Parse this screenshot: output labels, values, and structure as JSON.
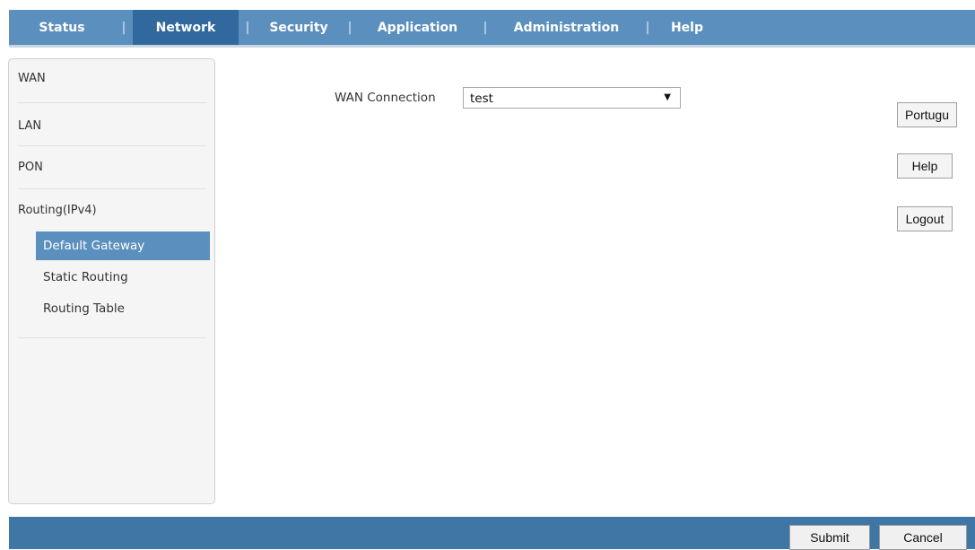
{
  "topnav": {
    "tabs": [
      {
        "label": "Status"
      },
      {
        "label": "Network",
        "active": true
      },
      {
        "label": "Security"
      },
      {
        "label": "Application"
      },
      {
        "label": "Administration"
      },
      {
        "label": "Help"
      }
    ],
    "separator": "|"
  },
  "sidebar": {
    "items": [
      {
        "label": "WAN"
      },
      {
        "label": "LAN"
      },
      {
        "label": "PON"
      },
      {
        "label": "Routing(IPv4)"
      }
    ],
    "subitems": [
      {
        "label": "Default Gateway",
        "active": true
      },
      {
        "label": "Static Routing"
      },
      {
        "label": "Routing Table"
      }
    ]
  },
  "form": {
    "wan_connection_label": "WAN Connection",
    "wan_connection_value": "test",
    "dropdown_icon": "triangle-down"
  },
  "side_buttons": {
    "language": "Portugu",
    "help": "Help",
    "logout": "Logout"
  },
  "footer": {
    "submit": "Submit",
    "cancel": "Cancel"
  },
  "colors": {
    "nav_bar": "#5b8fbd",
    "nav_active": "#31689d",
    "footer_bar": "#3e76a6",
    "submenu_active": "#5b8fbd"
  }
}
